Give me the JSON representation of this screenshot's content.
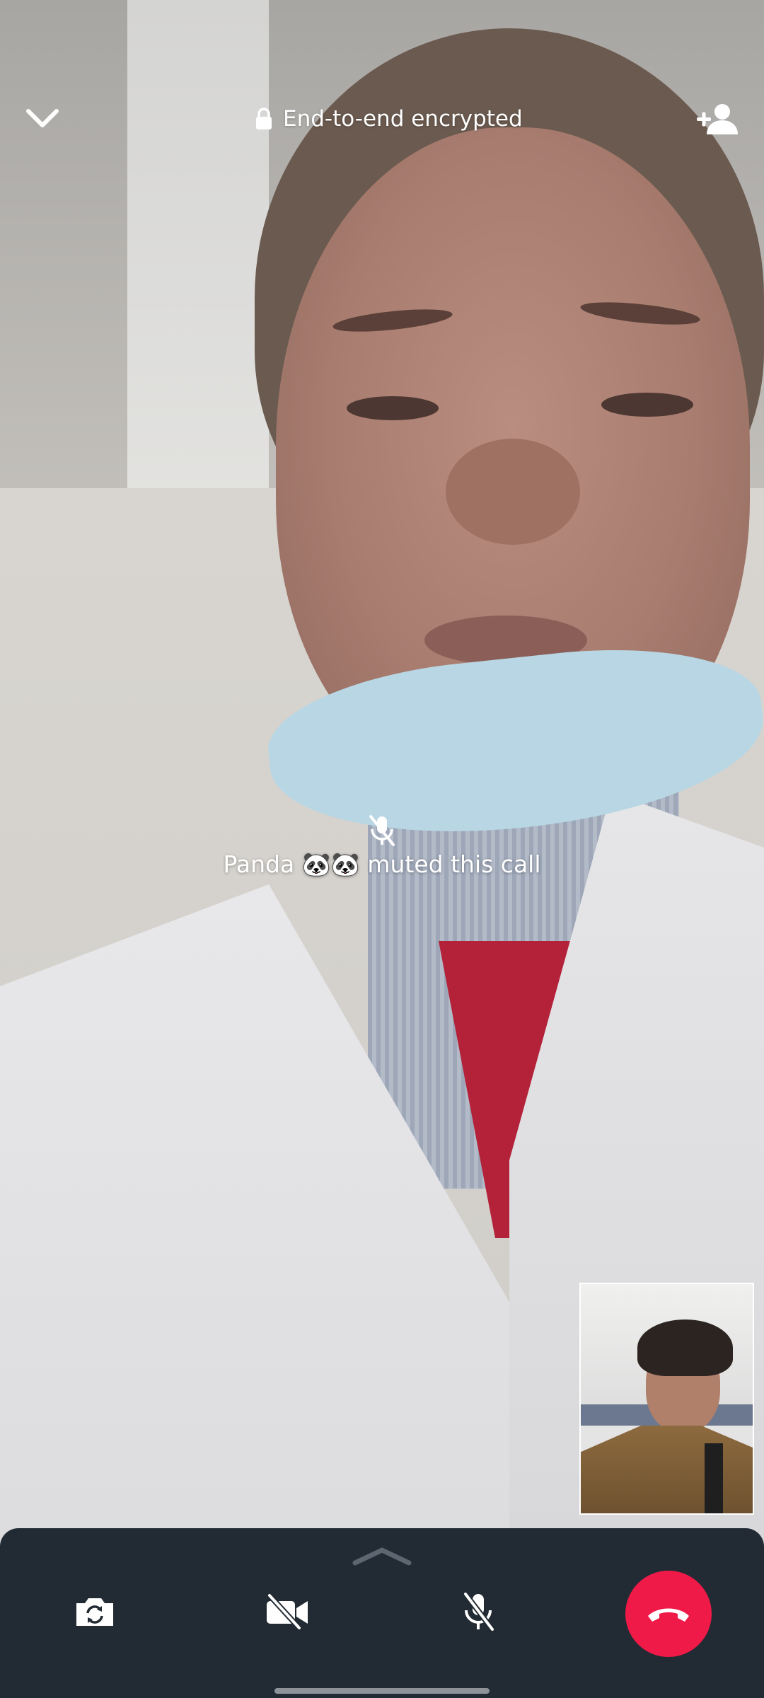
{
  "call": {
    "encryption_label": "End-to-end encrypted",
    "muted_notice": "Panda 🐼🐼 muted this call"
  },
  "icons": {
    "collapse": "chevron-down-icon",
    "lock": "lock-icon",
    "add_participant": "add-person-icon",
    "muted": "mic-off-icon",
    "panel_handle": "chevron-up-icon",
    "flip_camera": "camera-flip-icon",
    "video_off": "video-off-icon",
    "mic_off": "mic-off-icon",
    "end_call": "phone-hangup-icon"
  },
  "colors": {
    "controls_background": "#222b33",
    "end_call": "#ef1a48",
    "icon": "#ffffff"
  }
}
